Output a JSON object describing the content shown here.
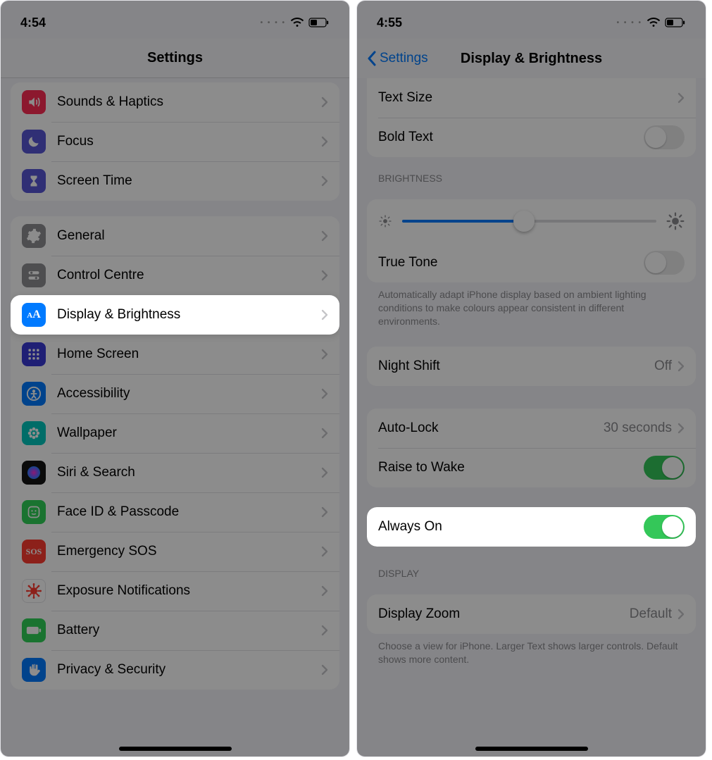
{
  "left": {
    "status_time": "4:54",
    "nav_title": "Settings",
    "group1": [
      {
        "name": "sounds-haptics",
        "label": "Sounds & Haptics",
        "icon_bg": "#ff2d55",
        "icon_glyph": "speaker"
      },
      {
        "name": "focus",
        "label": "Focus",
        "icon_bg": "#5856d6",
        "icon_glyph": "moon"
      },
      {
        "name": "screen-time",
        "label": "Screen Time",
        "icon_bg": "#5856d6",
        "icon_glyph": "hourglass"
      }
    ],
    "group2": [
      {
        "name": "general",
        "label": "General",
        "icon_bg": "#8e8e93",
        "icon_glyph": "gear"
      },
      {
        "name": "control-centre",
        "label": "Control Centre",
        "icon_bg": "#8e8e93",
        "icon_glyph": "switches"
      },
      {
        "name": "display-brightness",
        "label": "Display & Brightness",
        "icon_bg": "#007aff",
        "icon_glyph": "aa",
        "highlight": true
      },
      {
        "name": "home-screen",
        "label": "Home Screen",
        "icon_bg": "#3a3ad6",
        "icon_glyph": "grid"
      },
      {
        "name": "accessibility",
        "label": "Accessibility",
        "icon_bg": "#007aff",
        "icon_glyph": "person"
      },
      {
        "name": "wallpaper",
        "label": "Wallpaper",
        "icon_bg": "#00c7be",
        "icon_glyph": "flower"
      },
      {
        "name": "siri-search",
        "label": "Siri & Search",
        "icon_bg": "#141414",
        "icon_glyph": "siri"
      },
      {
        "name": "face-id-passcode",
        "label": "Face ID & Passcode",
        "icon_bg": "#30d158",
        "icon_glyph": "face"
      },
      {
        "name": "emergency-sos",
        "label": "Emergency SOS",
        "icon_bg": "#ff3b30",
        "icon_glyph": "sos"
      },
      {
        "name": "exposure-notifications",
        "label": "Exposure Notifications",
        "icon_bg": "#ffffff",
        "icon_glyph": "covid",
        "icon_fg": "#ff3b30",
        "icon_border": true
      },
      {
        "name": "battery",
        "label": "Battery",
        "icon_bg": "#30d158",
        "icon_glyph": "battery"
      },
      {
        "name": "privacy-security",
        "label": "Privacy & Security",
        "icon_bg": "#007aff",
        "icon_glyph": "hand"
      }
    ]
  },
  "right": {
    "status_time": "4:55",
    "nav_back": "Settings",
    "nav_title": "Display & Brightness",
    "text_group": [
      {
        "name": "text-size",
        "label": "Text Size",
        "type": "link"
      },
      {
        "name": "bold-text",
        "label": "Bold Text",
        "type": "toggle",
        "on": false
      }
    ],
    "brightness_header": "BRIGHTNESS",
    "brightness_pct": 48,
    "true_tone": {
      "label": "True Tone",
      "on": false
    },
    "true_tone_footer": "Automatically adapt iPhone display based on ambient lighting conditions to make colours appear consistent in different environments.",
    "night_shift": {
      "label": "Night Shift",
      "value": "Off"
    },
    "auto_lock": {
      "label": "Auto-Lock",
      "value": "30 seconds"
    },
    "raise_to_wake": {
      "label": "Raise to Wake",
      "on": true
    },
    "always_on": {
      "label": "Always On",
      "on": true,
      "highlight": true
    },
    "display_header": "DISPLAY",
    "display_zoom": {
      "label": "Display Zoom",
      "value": "Default"
    },
    "display_footer": "Choose a view for iPhone. Larger Text shows larger controls. Default shows more content."
  }
}
